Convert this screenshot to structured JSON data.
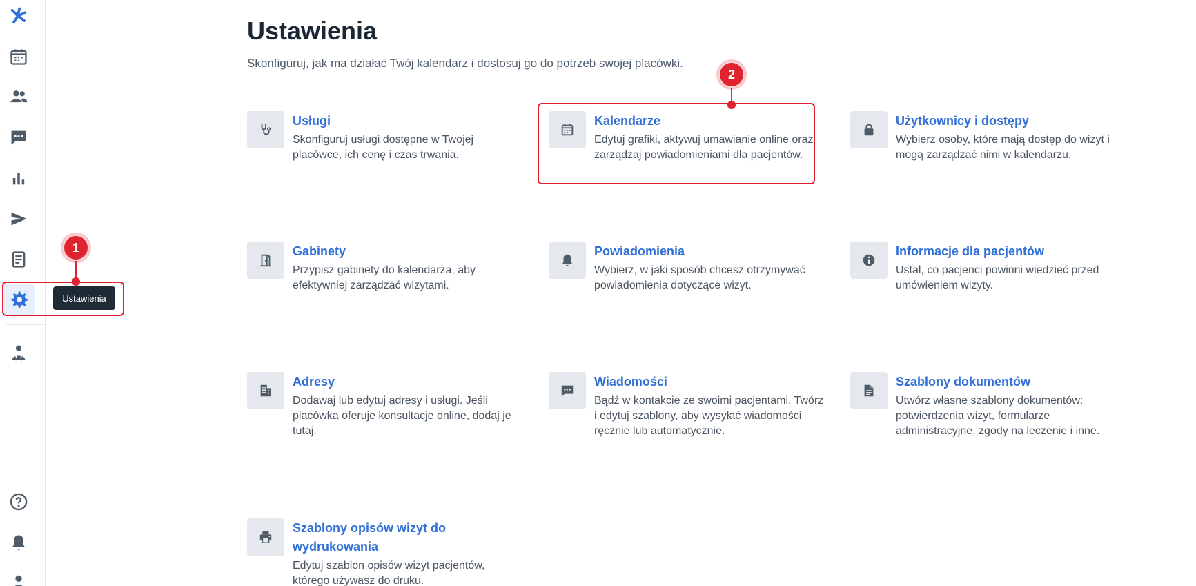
{
  "sidebar": {
    "items": [
      {
        "icon": "logo-icon"
      },
      {
        "icon": "calendar-icon"
      },
      {
        "icon": "patients-icon"
      },
      {
        "icon": "chat-icon"
      },
      {
        "icon": "stats-icon"
      },
      {
        "icon": "send-icon"
      },
      {
        "icon": "document-icon"
      },
      {
        "icon": "gear-icon",
        "active": true
      },
      {
        "icon": "doctor-icon"
      },
      {
        "icon": "help-icon"
      },
      {
        "icon": "bell-icon"
      },
      {
        "icon": "user-icon"
      }
    ],
    "tooltip": "Ustawienia",
    "accent_color": "#2f6fd6"
  },
  "annotations": {
    "badge1": "1",
    "badge2": "2",
    "color": "#e0232f"
  },
  "header": {
    "title": "Ustawienia",
    "subtitle": "Skonfiguruj, jak ma działać Twój kalendarz i dostosuj go do potrzeb swojej placówki."
  },
  "cards": [
    {
      "title": "Usługi",
      "desc": "Skonfiguruj usługi dostępne w Twojej placówce, ich cenę i czas trwania.",
      "icon": "stethoscope-icon"
    },
    {
      "title": "Kalendarze",
      "desc": "Edytuj grafiki, aktywuj umawianie online oraz zarządzaj powiadomieniami dla pacjentów.",
      "icon": "calendar-icon"
    },
    {
      "title": "Użytkownicy i dostępy",
      "desc": "Wybierz osoby, które mają dostęp do wizyt i mogą zarządzać nimi w kalendarzu.",
      "icon": "lock-icon"
    },
    {
      "title": "Gabinety",
      "desc": "Przypisz gabinety do kalendarza, aby efektywniej zarządzać wizytami.",
      "icon": "door-icon"
    },
    {
      "title": "Powiadomienia",
      "desc": "Wybierz, w jaki sposób chcesz otrzymywać powiadomienia dotyczące wizyt.",
      "icon": "bell-icon"
    },
    {
      "title": "Informacje dla pacjentów",
      "desc": "Ustal, co pacjenci powinni wiedzieć przed umówieniem wizyty.",
      "icon": "info-icon"
    },
    {
      "title": "Adresy",
      "desc": "Dodawaj lub edytuj adresy i usługi. Jeśli placówka oferuje konsultacje online, dodaj je tutaj.",
      "icon": "building-icon"
    },
    {
      "title": "Wiadomości",
      "desc": "Bądź w kontakcie ze swoimi pacjentami. Twórz i edytuj szablony, aby wysyłać wiadomości ręcznie lub automatycznie.",
      "icon": "message-icon"
    },
    {
      "title": "Szablony dokumentów",
      "desc": "Utwórz własne szablony dokumentów: potwierdzenia wizyt, formularze administracyjne, zgody na leczenie i inne.",
      "icon": "file-icon"
    },
    {
      "title": "Szablony opisów wizyt do wydrukowania",
      "desc": "Edytuj szablon opisów wizyt pacjentów, którego używasz do druku.",
      "icon": "printer-icon"
    }
  ]
}
